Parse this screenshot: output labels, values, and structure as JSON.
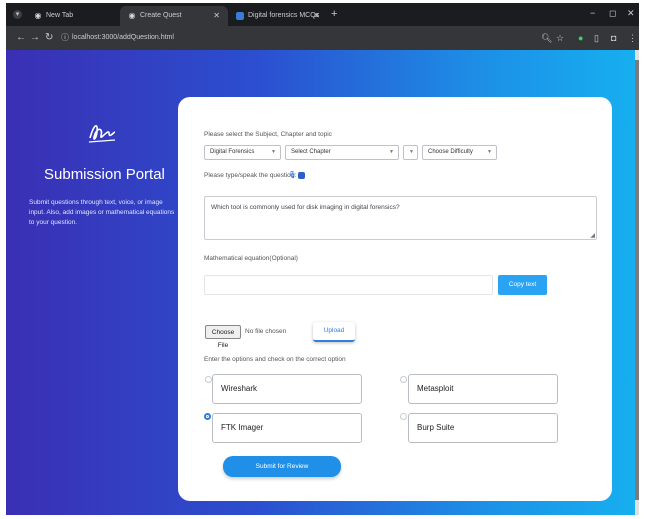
{
  "browser": {
    "tabs": [
      {
        "title": "New Tab",
        "icon": "chrome-icon",
        "active": false
      },
      {
        "title": "Create Quest",
        "icon": "app-icon",
        "active": true
      },
      {
        "title": "Digital forensics MCQs",
        "icon": "microsoft-icon",
        "active": false
      }
    ],
    "url": "localhost:3000/addQuestion.html"
  },
  "sidebar": {
    "title": "Submission Portal",
    "description": "Submit questions through text, voice, or image input. Also, add images or mathematical equations to your question."
  },
  "form": {
    "select_label": "Please select the Subject, Chapter and topic",
    "subject_select": "Digital Forensics",
    "chapter_select": "Select Chapter",
    "topic_select": "",
    "difficulty_select": "Choose Difficulty",
    "question_label": "Please type/speak the question:",
    "question_text": "Which tool is commonly used for disk imaging in digital forensics?",
    "equation_label": "Mathematical equation(Optional)",
    "equation_value": "",
    "copy_button": "Copy text",
    "choose_file_button": "Choose File",
    "file_status": "No file chosen",
    "upload_button": "Upload",
    "options_label": "Enter the options and check on the correct option",
    "options": [
      {
        "text": "Wireshark",
        "checked": false
      },
      {
        "text": "Metasploit",
        "checked": false
      },
      {
        "text": "FTK Imager",
        "checked": true
      },
      {
        "text": "Burp Suite",
        "checked": false
      }
    ],
    "submit_button": "Submit for Review"
  },
  "colors": {
    "gradient_start": "#3a2fb4",
    "gradient_end": "#16b0f0",
    "accent": "#1f8fe8"
  }
}
